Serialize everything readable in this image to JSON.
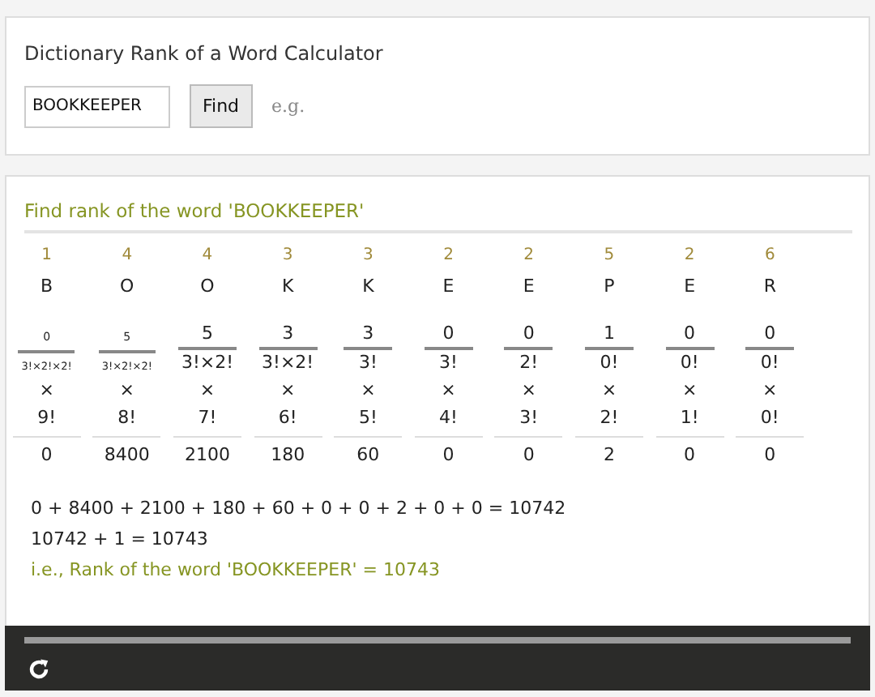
{
  "calculator": {
    "title": "Dictionary Rank of a Word Calculator",
    "input": {
      "value": "BOOKKEEPER"
    },
    "button": "Find",
    "example": "e.g."
  },
  "result": {
    "heading": "Find rank of the word 'BOOKKEEPER'",
    "columns": [
      {
        "rank": "1",
        "letter": "B",
        "kind": "small",
        "numerator": "0",
        "denominator": "3!×2!×2!",
        "factorial": "9!",
        "term": "0"
      },
      {
        "rank": "4",
        "letter": "O",
        "kind": "small",
        "numerator": "5",
        "denominator": "3!×2!×2!",
        "factorial": "8!",
        "term": "8400"
      },
      {
        "rank": "4",
        "letter": "O",
        "kind": "normal",
        "numerator": "5",
        "denominator": "3!×2!",
        "factorial": "7!",
        "term": "2100"
      },
      {
        "rank": "3",
        "letter": "K",
        "kind": "normal",
        "numerator": "3",
        "denominator": "3!×2!",
        "factorial": "6!",
        "term": "180"
      },
      {
        "rank": "3",
        "letter": "K",
        "kind": "normal",
        "numerator": "3",
        "denominator": "3!",
        "factorial": "5!",
        "term": "60"
      },
      {
        "rank": "2",
        "letter": "E",
        "kind": "normal",
        "numerator": "0",
        "denominator": "3!",
        "factorial": "4!",
        "term": "0"
      },
      {
        "rank": "2",
        "letter": "E",
        "kind": "normal",
        "numerator": "0",
        "denominator": "2!",
        "factorial": "3!",
        "term": "0"
      },
      {
        "rank": "5",
        "letter": "P",
        "kind": "normal",
        "numerator": "1",
        "denominator": "0!",
        "factorial": "2!",
        "term": "2"
      },
      {
        "rank": "2",
        "letter": "E",
        "kind": "normal",
        "numerator": "0",
        "denominator": "0!",
        "factorial": "1!",
        "term": "0"
      },
      {
        "rank": "6",
        "letter": "R",
        "kind": "normal",
        "numerator": "0",
        "denominator": "0!",
        "factorial": "0!",
        "term": "0"
      }
    ],
    "times": "×",
    "lines": [
      "0 + 8400 + 2100 + 180 + 60 + 0 + 0 + 2 + 0 + 0 = 10742",
      "10742 + 1 = 10743"
    ],
    "conclusion": "i.e., Rank of the word 'BOOKKEEPER' = 10743"
  }
}
